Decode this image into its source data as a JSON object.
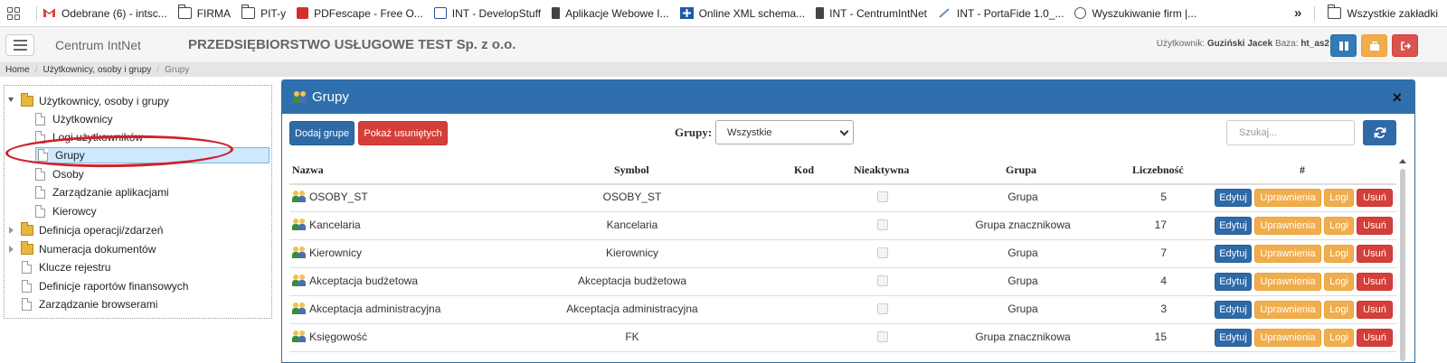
{
  "bookmarks": {
    "items": [
      {
        "label": "Odebrane (6) - intsc...",
        "icon": "gmail-icon"
      },
      {
        "label": "FIRMA",
        "icon": "folder-icon"
      },
      {
        "label": "PIT-y",
        "icon": "folder-icon"
      },
      {
        "label": "PDFescape - Free O...",
        "icon": "pdf-icon"
      },
      {
        "label": "INT - DevelopStuff",
        "icon": "app-icon"
      },
      {
        "label": "Aplikacje Webowe I...",
        "icon": "page-icon"
      },
      {
        "label": "Online XML schema...",
        "icon": "plus-icon"
      },
      {
        "label": "INT - CentrumIntNet",
        "icon": "page-icon"
      },
      {
        "label": "INT - PortaFide 1.0_...",
        "icon": "pen-icon"
      },
      {
        "label": "Wyszukiwanie firm |...",
        "icon": "globe-icon"
      }
    ],
    "more": "»",
    "all_bookmarks": "Wszystkie zakładki"
  },
  "topbar": {
    "brand": "Centrum IntNet",
    "company": "PRZEDSIĘBIORSTWO USŁUGOWE TEST Sp. z o.o.",
    "user_label": "Użytkownik:",
    "user_name": "Guziński Jacek",
    "db_label": "Baza:",
    "db_name": "ht_as2",
    "colors": {
      "blue": "#337ab7",
      "orange": "#f0ad4e",
      "red": "#d9534f"
    }
  },
  "breadcrumb": [
    "Home",
    "Użytkownicy, osoby i grupy",
    "Grupy"
  ],
  "tree": {
    "root": "Użytkownicy, osoby i grupy",
    "children": [
      "Użytkownicy",
      "Logi użytkowników",
      "Grupy",
      "Osoby",
      "Zarządzanie aplikacjami",
      "Kierowcy"
    ],
    "selected": "Grupy",
    "others": [
      "Definicja operacji/zdarzeń",
      "Numeracja dokumentów"
    ],
    "leaves": [
      "Klucze rejestru",
      "Definicje raportów finansowych",
      "Zarządzanie browserami"
    ]
  },
  "panel": {
    "title": "Grupy",
    "close": "×",
    "add_button": "Dodaj grupe",
    "show_deleted_button": "Pokaż usuniętych",
    "filter_label": "Grupy:",
    "filter_value": "Wszystkie",
    "search_placeholder": "Szukaj...",
    "columns": [
      "Nazwa",
      "Symbol",
      "Kod",
      "Nieaktywna",
      "Grupa",
      "Liczebność",
      "#"
    ],
    "row_buttons": {
      "edit": "Edytuj",
      "permissions": "Uprawnienia",
      "logs": "Logi",
      "delete": "Usuń"
    },
    "rows": [
      {
        "name": "OSOBY_ST",
        "symbol": "OSOBY_ST",
        "code": "",
        "group": "Grupa",
        "count": "5"
      },
      {
        "name": "Kancelaria",
        "symbol": "Kancelaria",
        "code": "",
        "group": "Grupa znacznikowa",
        "count": "17"
      },
      {
        "name": "Kierownicy",
        "symbol": "Kierownicy",
        "code": "",
        "group": "Grupa",
        "count": "7"
      },
      {
        "name": "Akceptacja budżetowa",
        "symbol": "Akceptacja budżetowa",
        "code": "",
        "group": "Grupa",
        "count": "4"
      },
      {
        "name": "Akceptacja administracyjna",
        "symbol": "Akceptacja administracyjna",
        "code": "",
        "group": "Grupa",
        "count": "3"
      },
      {
        "name": "Księgowość",
        "symbol": "FK",
        "code": "",
        "group": "Grupa znacznikowa",
        "count": "15"
      }
    ]
  }
}
